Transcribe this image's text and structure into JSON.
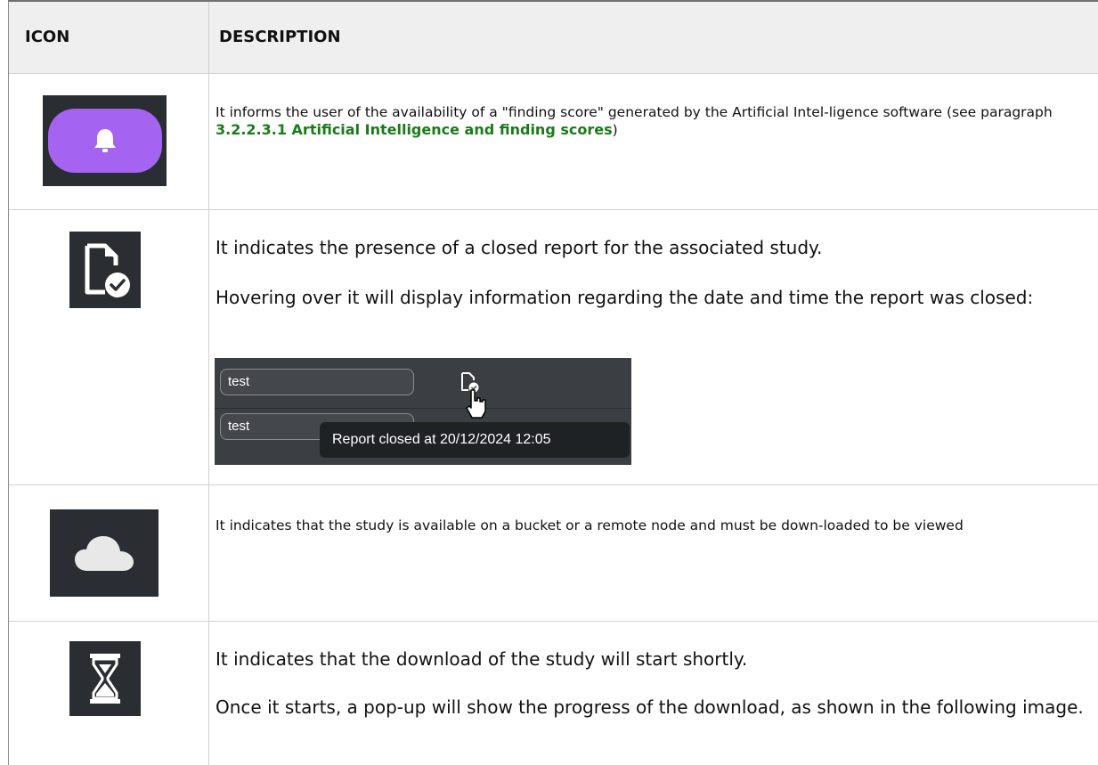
{
  "table": {
    "headers": {
      "icon": "ICON",
      "description": "DESCRIPTION"
    }
  },
  "rows": [
    {
      "icon": "bell-icon",
      "text_before": "It informs the user of the availability of a \"finding score\" generated by the Artificial Intel-ligence software (see paragraph ",
      "link": "3.2.2.3.1 Artificial Intelligence and finding scores",
      "text_after": ")",
      "accent": "#a463f0"
    },
    {
      "icon": "closed-report-icon",
      "paragraph1": "It indicates the presence of a closed report for the associated study.",
      "paragraph2": "Hovering over it will display information regarding the date and time the report was closed:",
      "screenshot": {
        "field1": "test",
        "field2": "test",
        "tooltip": "Report closed at 20/12/2024 12:05"
      }
    },
    {
      "icon": "cloud-icon",
      "text": "It indicates that the study is available on a bucket or a remote node and must be down-loaded to be viewed"
    },
    {
      "icon": "hourglass-icon",
      "paragraph1": "It indicates that the download of the study will start shortly.",
      "paragraph2": "Once it starts, a pop-up will show the progress of the download, as shown in the following image."
    }
  ],
  "colors": {
    "link": "#1a7a1a",
    "icon_bg": "#2a2e33",
    "header_bg": "#efefef"
  }
}
